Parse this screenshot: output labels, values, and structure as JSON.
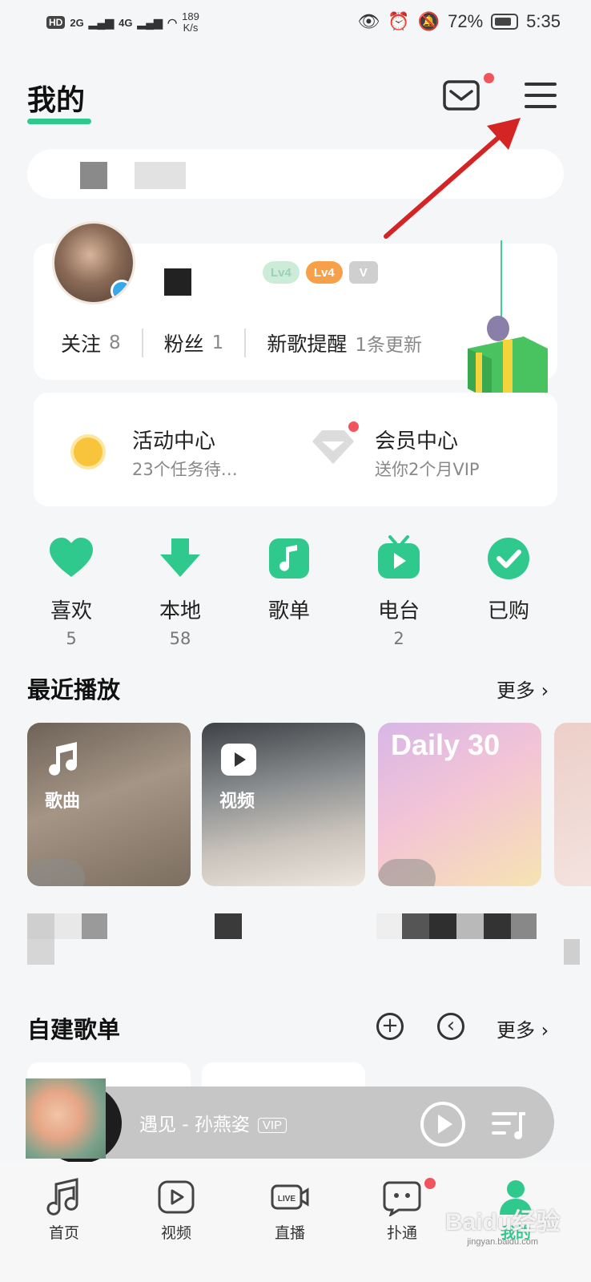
{
  "status_bar": {
    "hd": "HD",
    "signal1": "2G",
    "signal2": "4G",
    "speed_value": "189",
    "speed_unit": "K/s",
    "battery": "72%",
    "time": "5:35"
  },
  "header": {
    "title": "我的"
  },
  "profile": {
    "badges": [
      "Lv4",
      "Lv4"
    ],
    "stats": [
      {
        "label": "关注",
        "count": "8"
      },
      {
        "label": "粉丝",
        "count": "1"
      },
      {
        "label": "新歌提醒",
        "count": "1条更新"
      }
    ]
  },
  "activity": {
    "center": {
      "title": "活动中心",
      "subtitle": "23个任务待…"
    },
    "vip": {
      "title": "会员中心",
      "subtitle": "送你2个月VIP"
    }
  },
  "quick_actions": [
    {
      "label": "喜欢",
      "count": "5",
      "icon": "heart-icon"
    },
    {
      "label": "本地",
      "count": "58",
      "icon": "download-icon"
    },
    {
      "label": "歌单",
      "count": "",
      "icon": "music-note-icon"
    },
    {
      "label": "电台",
      "count": "2",
      "icon": "tv-radio-icon"
    },
    {
      "label": "已购",
      "count": "",
      "icon": "check-icon"
    }
  ],
  "recent": {
    "title": "最近播放",
    "more": "更多",
    "tiles": [
      {
        "label": "歌曲",
        "icon": "music-note-icon"
      },
      {
        "label": "视频",
        "icon": "video-play-icon"
      },
      {
        "label": "Daily 30"
      }
    ]
  },
  "playlists": {
    "title": "自建歌单",
    "more": "更多"
  },
  "player": {
    "song": "遇见 - 孙燕姿",
    "tag": "VIP"
  },
  "nav": [
    {
      "label": "首页",
      "icon": "music-note-icon"
    },
    {
      "label": "视频",
      "icon": "video-icon"
    },
    {
      "label": "直播",
      "icon": "live-icon"
    },
    {
      "label": "扑通",
      "icon": "chat-face-icon"
    },
    {
      "label": "我的",
      "icon": "user-icon"
    }
  ],
  "watermark": {
    "text": "Baidu经验",
    "sub": "jingyan.baidu.com"
  },
  "colors": {
    "accent": "#2fc98d",
    "dot": "#f1545c",
    "badge_orange": "#f6a04a"
  }
}
